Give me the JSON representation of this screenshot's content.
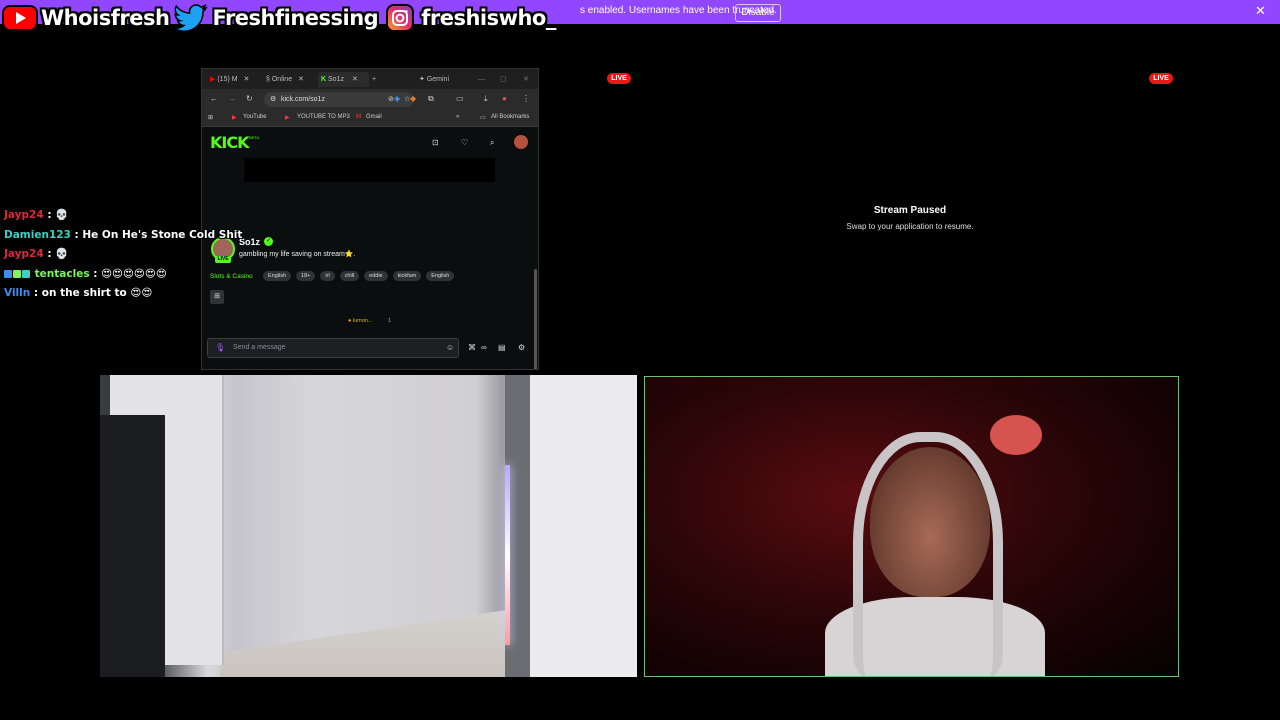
{
  "banner": {
    "text": "s enabled. Usernames have been truncated.",
    "disable_label": "Disable",
    "close_label": "✕"
  },
  "socials": [
    {
      "icon": "youtube-icon",
      "handle": "Whoisfresh"
    },
    {
      "icon": "twitter-icon",
      "handle": "Freshfinessing"
    },
    {
      "icon": "instagram-icon",
      "handle": "freshiswho_"
    }
  ],
  "browser": {
    "tabs": [
      {
        "label": "(15) M"
      },
      {
        "label": "Online"
      },
      {
        "label": "So1z"
      },
      {
        "label": "Gemini"
      }
    ],
    "url": "kick.com/so1z",
    "bookmarks": {
      "youtube": "YouTube",
      "mp3": "YOUTUBE TO MP3",
      "gmail": "Gmail",
      "all": "All Bookmarks"
    }
  },
  "kick": {
    "logo": "KICK",
    "beta": "BETA",
    "streamer": "So1z",
    "live_label": "LIVE",
    "title": "gambling my life saving on stream⭐.",
    "category": "Slots & Casino",
    "tags": [
      "English",
      "18+",
      "irl",
      "chill",
      "eddie",
      "kickfam",
      "English"
    ],
    "pinned_user": "lumon...",
    "pinned_count": "1",
    "chat_placeholder": "Send a message"
  },
  "chat_overlay": [
    {
      "user": "Jayp24",
      "color": "#e0243a",
      "text": ": 💀"
    },
    {
      "user": "Damien123",
      "color": "#3bd1c6",
      "text": ": He On He's Stone Cold Shit"
    },
    {
      "user": "Jayp24",
      "color": "#e0243a",
      "text": ": 💀"
    },
    {
      "user": "tentacles",
      "color": "#7cf75a",
      "text": ": 😍😍😍😍😍😍"
    },
    {
      "user": "Villn",
      "color": "#3b8cf0",
      "text": ": on the shirt to 😍😍"
    }
  ],
  "live_badges": {
    "left": "LIVE",
    "right": "LIVE"
  },
  "paused": {
    "title": "Stream Paused",
    "subtitle": "Swap to your application to resume."
  },
  "colors": {
    "banner": "#9146ff",
    "kick_green": "#53fc18",
    "live_red": "#e91916"
  }
}
